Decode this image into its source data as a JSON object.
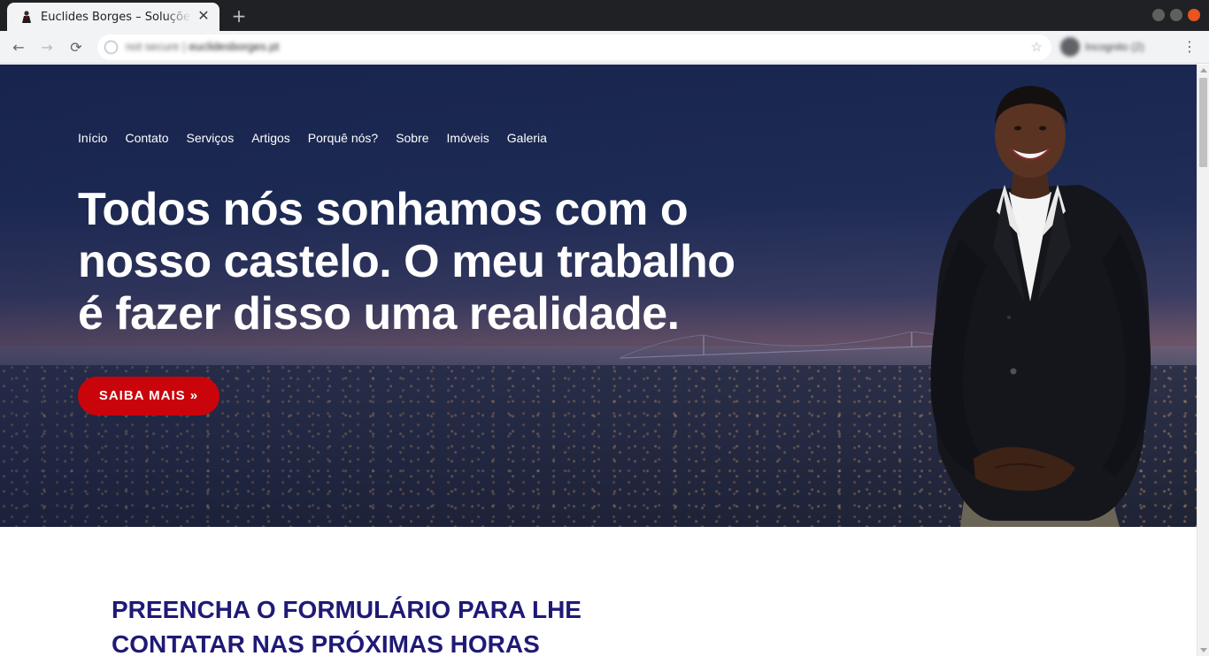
{
  "browser": {
    "tab": {
      "title": "Euclides Borges – Soluções Imobiliárias",
      "close_glyph": "✕"
    },
    "new_tab_glyph": "+",
    "nav": {
      "back_glyph": "←",
      "forward_glyph": "→",
      "reload_glyph": "⟳"
    },
    "address": {
      "prefix": "not secure",
      "host": "euclidesborges.pt"
    },
    "star_glyph": "☆",
    "profile_label": "Incognito (2)",
    "menu_glyph": "⋮"
  },
  "site": {
    "nav_items": [
      "Início",
      "Contato",
      "Serviços",
      "Artigos",
      "Porquê nós?",
      "Sobre",
      "Imóveis",
      "Galeria"
    ],
    "headline": "Todos nós sonhamos com o nosso castelo. O meu trabalho é fazer disso uma realidade.",
    "cta_label": "SAIBA MAIS »",
    "form_heading": "PREENCHA O FORMULÁRIO PARA LHE CONTATAR NAS PRÓXIMAS HORAS"
  },
  "colors": {
    "hero_navy": "#1a2750",
    "cta_red": "#c9040b",
    "heading_indigo": "#1f1a76"
  }
}
